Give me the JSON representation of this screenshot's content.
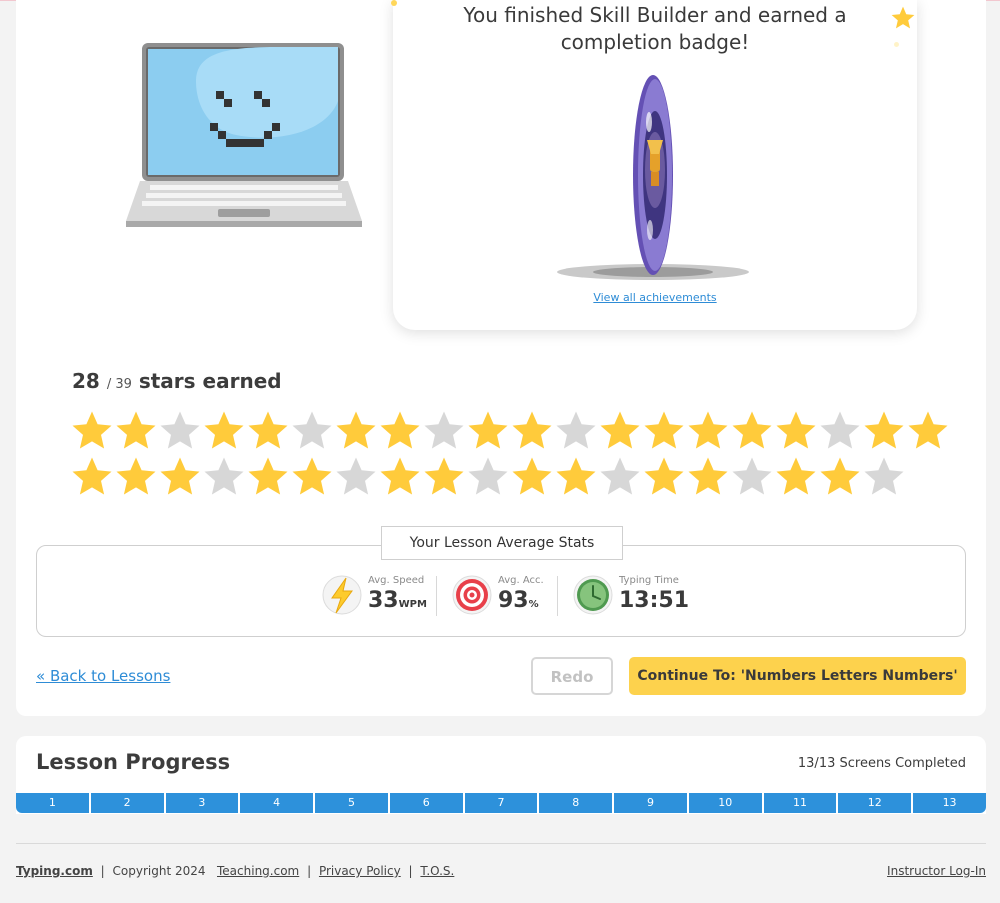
{
  "modal": {
    "message": "You finished Skill Builder and earned a completion badge!",
    "achievements_link": "View all achievements"
  },
  "stars": {
    "earned": "28",
    "total": "/ 39",
    "label": "stars earned",
    "filled_color": "#ffcb3b",
    "empty_color": "#d7d7d7",
    "row1": [
      1,
      1,
      0,
      1,
      1,
      0,
      1,
      1,
      0,
      1,
      1,
      0,
      1,
      1,
      1,
      1,
      1,
      0,
      1,
      1
    ],
    "row2": [
      1,
      1,
      1,
      0,
      1,
      1,
      0,
      1,
      1,
      0,
      1,
      1,
      0,
      1,
      1,
      0,
      1,
      1,
      0
    ]
  },
  "stats": {
    "title": "Your Lesson Average Stats",
    "speed_label": "Avg. Speed",
    "speed_value": "33",
    "speed_unit": "WPM",
    "accuracy_label": "Avg. Acc.",
    "accuracy_value": "93",
    "accuracy_unit": "%",
    "time_label": "Typing Time",
    "time_value": "13:51"
  },
  "actions": {
    "back": "« Back to Lessons",
    "redo": "Redo",
    "continue": "Continue To: 'Numbers Letters Numbers'"
  },
  "progress": {
    "title": "Lesson Progress",
    "status": "13/13 Screens Completed",
    "segments": [
      "1",
      "2",
      "3",
      "4",
      "5",
      "6",
      "7",
      "8",
      "9",
      "10",
      "11",
      "12",
      "13"
    ],
    "color": "#2d91db"
  },
  "footer": {
    "brand": "Typing.com",
    "copyright": "Copyright 2024",
    "teaching": "Teaching.com",
    "privacy": "Privacy Policy",
    "tos": "T.O.S.",
    "instructor": "Instructor Log-In"
  }
}
